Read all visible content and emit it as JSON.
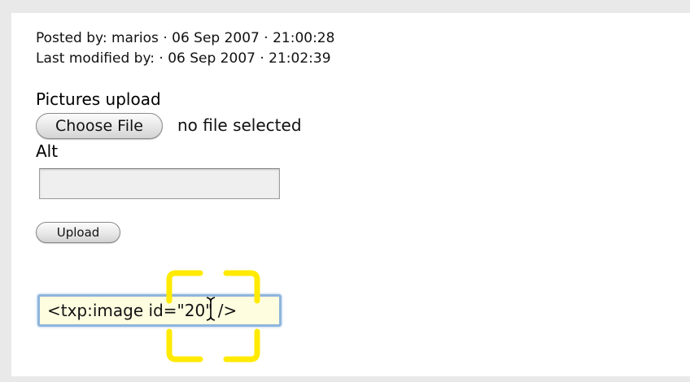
{
  "post_info": {
    "posted_line": "Posted by: marios · 06 Sep 2007 · 21:00:28",
    "modified_line": "Last modified by:  · 06 Sep 2007 · 21:02:39"
  },
  "upload": {
    "section_label": "Pictures upload",
    "choose_file_label": "Choose File",
    "file_status": "no file selected",
    "alt_label": "Alt",
    "alt_value": "",
    "upload_label": "Upload"
  },
  "code_field": {
    "value": "<txp:image id=\"20\" />"
  },
  "icons": {
    "focus_highlight": "focus-brackets-icon",
    "text_cursor": "i-beam-cursor-icon"
  },
  "colors": {
    "highlight": "#ffea00",
    "field_focus_border": "#8fb5dc",
    "code_field_background": "#fffde0"
  }
}
